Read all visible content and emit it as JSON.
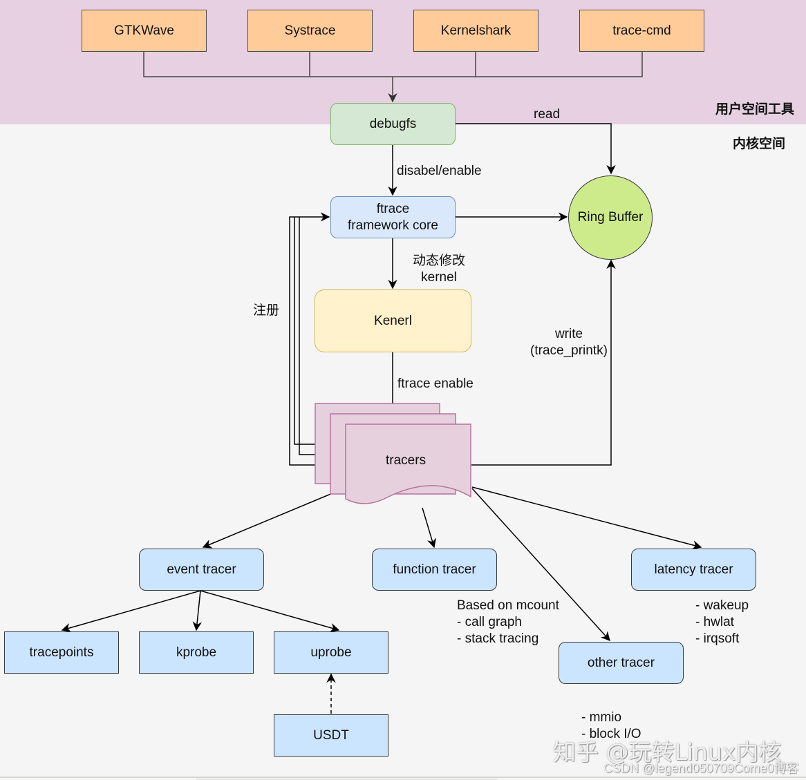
{
  "zones": {
    "user_space": "用户空间工具",
    "kernel_space": "内核空间"
  },
  "user_tools": [
    "GTKWave",
    "Systrace",
    "Kernelshark",
    "trace-cmd"
  ],
  "nodes": {
    "debugfs": "debugfs",
    "ftrace_core_line1": "ftrace",
    "ftrace_core_line2": "framework core",
    "ring_buffer": "Ring Buffer",
    "kernel": "Kenerl",
    "tracers": "tracers",
    "event_tracer": "event tracer",
    "function_tracer": "function tracer",
    "latency_tracer": "latency tracer",
    "other_tracer": "other tracer",
    "tracepoints": "tracepoints",
    "kprobe": "kprobe",
    "uprobe": "uprobe",
    "usdt": "USDT"
  },
  "edge_labels": {
    "read": "read",
    "disable_enable": "disabel/enable",
    "dynamic_modify_line1": "动态修改",
    "dynamic_modify_line2": "kernel",
    "register": "注册",
    "write_line1": "write",
    "write_line2": "(trace_printk)",
    "ftrace_enable": "ftrace enable"
  },
  "notes": {
    "function_tracer": [
      "Based on mcount",
      "- call graph",
      "- stack tracing"
    ],
    "latency_tracer": [
      "- wakeup",
      "- hwlat",
      "- irqsoft"
    ],
    "other_tracer": [
      "- mmio",
      "- block I/O"
    ]
  },
  "watermarks": {
    "zhihu": "知乎 @玩转Linux内核",
    "csdn": "CSDN @legend050709Come0博客"
  },
  "colors": {
    "user_band": "#e6d0e2",
    "tool_fill": "#ffcc99",
    "debugfs_fill": "#d5e8d4",
    "ftrace_fill": "#dae8fc",
    "kernel_fill": "#fff2cc",
    "tracers_fill": "#e6d0de",
    "tracer_box_fill": "#cce5ff",
    "ring_buffer_fill": "#cdeb8b"
  }
}
